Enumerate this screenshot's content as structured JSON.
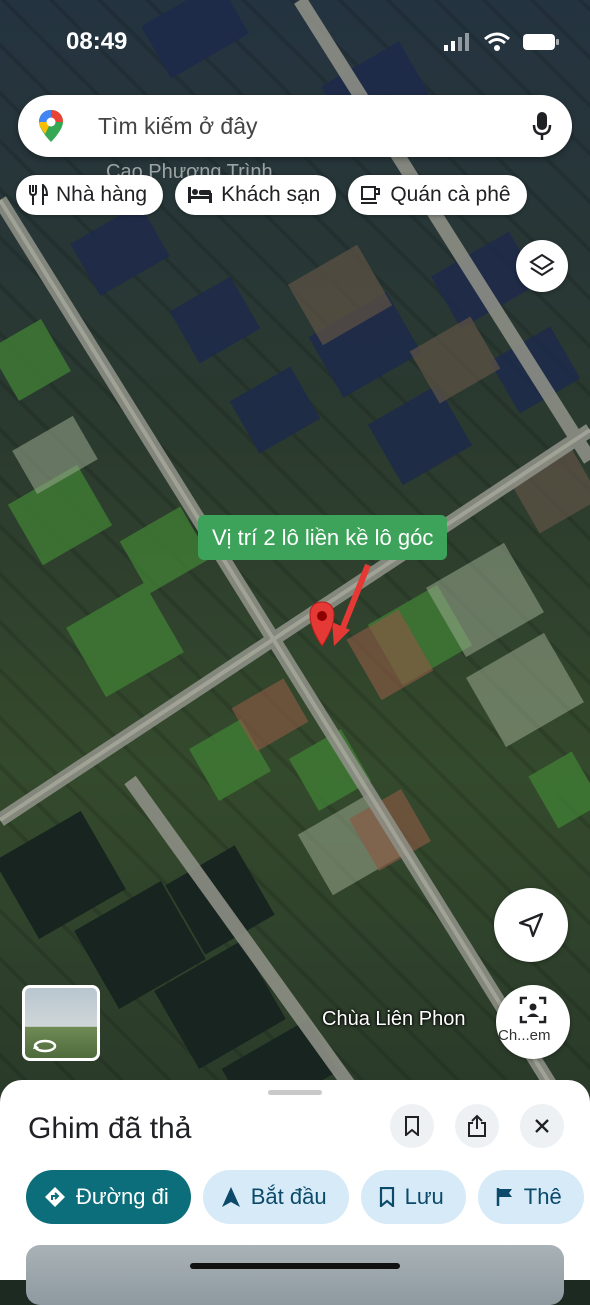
{
  "status_bar": {
    "time": "08:49"
  },
  "search": {
    "placeholder": "Tìm kiếm ở đây"
  },
  "chips": [
    {
      "icon": "restaurant-icon",
      "label": "Nhà hàng"
    },
    {
      "icon": "hotel-icon",
      "label": "Khách sạn"
    },
    {
      "icon": "coffee-icon",
      "label": "Quán cà phê"
    }
  ],
  "map": {
    "faded_label": "Cao Phượng Trình",
    "annotation": "Vị trí 2 lô liền kề lô góc",
    "place_label": "Chùa Liên Phon",
    "streetview_label": "Ch...em"
  },
  "sheet": {
    "title": "Ghim đã thả",
    "actions": [
      {
        "icon": "directions-icon",
        "label": "Đường đi",
        "primary": true
      },
      {
        "icon": "navigation-icon",
        "label": "Bắt đầu"
      },
      {
        "icon": "bookmark-icon",
        "label": "Lưu"
      },
      {
        "icon": "flag-icon",
        "label": "Thê"
      }
    ]
  },
  "colors": {
    "annotation_bg": "#3da35a",
    "primary_action": "#0c6e7a",
    "pin": "#e53935"
  }
}
